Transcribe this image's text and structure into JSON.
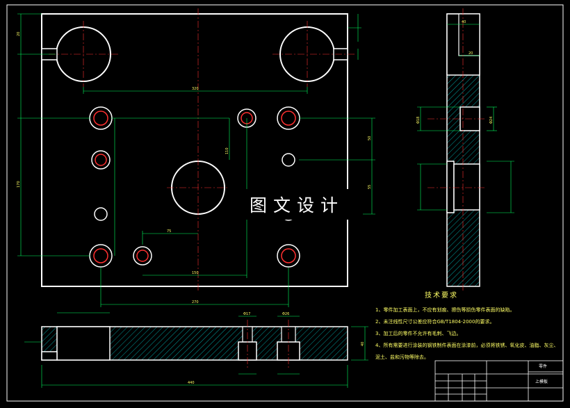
{
  "watermark": "图文设计",
  "notes": {
    "title": "技术要求",
    "lines": [
      "1、零件加工表面上，不应有划痕、擦伤等损伤零件表面的缺陷。",
      "2、未注线性尺寸公差应符合GB/T1804-2000的要求。",
      "3、加工后的零件不允许有毛刺、飞边。",
      "4、所有需要进行涂装的钢铁制件表面在涂漆前，必须将铁锈、氧化皮、油脂、灰尘、",
      "泥土、盐和污物等除去。"
    ]
  },
  "title_block": {
    "part_name": "上模板",
    "label_a": "零件"
  },
  "dimensions": {
    "h_boss_spacing": "320",
    "h_bottom": "270",
    "h_mid": "150",
    "h_small": "75",
    "total_length": "440",
    "v_left": "170",
    "v_mid": "110",
    "v_right": "50",
    "v_right2": "55",
    "v_top": "20",
    "side_thickness": "40",
    "side_step": "20",
    "hole_a": "Φ17",
    "hole_b": "Φ26",
    "hole_c": "Φ18",
    "hole_d": "Φ24"
  }
}
